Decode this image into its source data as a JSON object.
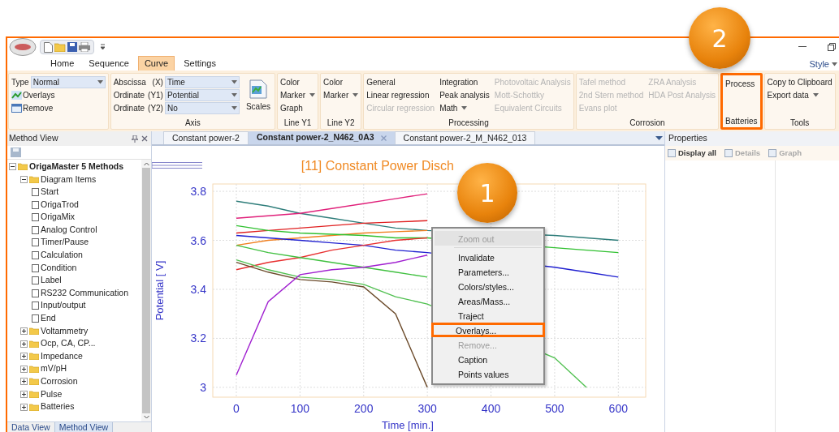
{
  "app": {
    "tabs": [
      {
        "label": "Home",
        "selected": false
      },
      {
        "label": "Sequence",
        "selected": false
      },
      {
        "label": "Curve",
        "selected": true
      },
      {
        "label": "Settings",
        "selected": false
      }
    ],
    "style_menu": "Style"
  },
  "ribbon": [
    {
      "highlighted": false,
      "columns": [
        [
          {
            "kind": "dropdown",
            "label": "Type",
            "value": "Normal"
          },
          {
            "kind": "icon-command",
            "label": "Overlays"
          },
          {
            "kind": "icon-command",
            "label": "Remove"
          }
        ]
      ]
    },
    {
      "label": "Axis",
      "highlighted": false,
      "columns": [
        [
          {
            "kind": "dropdown",
            "label": "Abscissa",
            "tag": "(X)",
            "value": "Time"
          },
          {
            "kind": "dropdown",
            "label": "Ordinate",
            "tag": "(Y1)",
            "value": "Potential"
          },
          {
            "kind": "dropdown",
            "label": "Ordinate",
            "tag": "(Y2)",
            "value": "No"
          }
        ],
        [
          {
            "kind": "large-button",
            "label": "Scales"
          }
        ]
      ]
    },
    {
      "label": "Line Y1",
      "highlighted": false,
      "columns": [
        [
          {
            "kind": "command",
            "label": "Color",
            "disabled": false
          },
          {
            "kind": "menu",
            "label": "Marker",
            "disabled": false
          },
          {
            "kind": "command",
            "label": "Graph",
            "disabled": false
          }
        ]
      ]
    },
    {
      "label": "Line Y2",
      "highlighted": false,
      "columns": [
        [
          {
            "kind": "command",
            "label": "Color",
            "disabled": false
          },
          {
            "kind": "menu",
            "label": "Marker",
            "disabled": false
          }
        ]
      ]
    },
    {
      "label": "Processing",
      "highlighted": false,
      "columns": [
        [
          {
            "kind": "command",
            "label": "General",
            "disabled": false
          },
          {
            "kind": "command",
            "label": "Linear regression",
            "disabled": false
          },
          {
            "kind": "command",
            "label": "Circular regression",
            "disabled": true
          }
        ],
        [
          {
            "kind": "command",
            "label": "Integration",
            "disabled": false
          },
          {
            "kind": "command",
            "label": "Peak analysis",
            "disabled": false
          },
          {
            "kind": "menu",
            "label": "Math",
            "disabled": false
          }
        ],
        [
          {
            "kind": "command",
            "label": "Photovoltaic Analysis",
            "disabled": true
          },
          {
            "kind": "command",
            "label": "Mott-Schottky",
            "disabled": true
          },
          {
            "kind": "command",
            "label": "Equivalent Circuits",
            "disabled": true
          }
        ]
      ]
    },
    {
      "label": "Corrosion",
      "highlighted": false,
      "columns": [
        [
          {
            "kind": "command",
            "label": "Tafel method",
            "disabled": true
          },
          {
            "kind": "command",
            "label": "2nd Stern method",
            "disabled": true
          },
          {
            "kind": "command",
            "label": "Evans plot",
            "disabled": true
          }
        ],
        [
          {
            "kind": "command",
            "label": "ZRA Analysis",
            "disabled": true
          },
          {
            "kind": "command",
            "label": "HDA Post Analysis",
            "disabled": true
          }
        ]
      ]
    },
    {
      "label": "Batteries",
      "highlighted": true,
      "columns": [
        [
          {
            "kind": "command",
            "label": "Process",
            "disabled": false
          }
        ]
      ]
    },
    {
      "label": "Tools",
      "highlighted": false,
      "columns": [
        [
          {
            "kind": "command",
            "label": "Copy to Clipboard",
            "disabled": false
          },
          {
            "kind": "menu",
            "label": "Export data",
            "disabled": false
          }
        ]
      ]
    }
  ],
  "method_view": {
    "title": "Method View",
    "tree": [
      {
        "label": "OrigaMaster 5 Methods",
        "kind": "folder",
        "expanded": true,
        "children": [
          {
            "label": "Diagram Items",
            "kind": "folder",
            "expanded": true,
            "children": [
              {
                "label": "Start",
                "kind": "leaf"
              },
              {
                "label": "OrigaTrod",
                "kind": "leaf"
              },
              {
                "label": "OrigaMix",
                "kind": "leaf"
              },
              {
                "label": "Analog Control",
                "kind": "leaf"
              },
              {
                "label": "Timer/Pause",
                "kind": "leaf"
              },
              {
                "label": "Calculation",
                "kind": "leaf"
              },
              {
                "label": "Condition",
                "kind": "leaf"
              },
              {
                "label": "Label",
                "kind": "leaf"
              },
              {
                "label": "RS232 Communication",
                "kind": "leaf"
              },
              {
                "label": "Input/output",
                "kind": "leaf"
              },
              {
                "label": "End",
                "kind": "leaf"
              }
            ]
          },
          {
            "label": "Voltammetry",
            "kind": "folder",
            "expanded": false
          },
          {
            "label": "Ocp, CA, CP...",
            "kind": "folder",
            "expanded": false
          },
          {
            "label": "Impedance",
            "kind": "folder",
            "expanded": false
          },
          {
            "label": "mV/pH",
            "kind": "folder",
            "expanded": false
          },
          {
            "label": "Corrosion",
            "kind": "folder",
            "expanded": false
          },
          {
            "label": "Pulse",
            "kind": "folder",
            "expanded": false
          },
          {
            "label": "Batteries",
            "kind": "folder",
            "expanded": false
          }
        ]
      }
    ],
    "bottom_tabs": [
      {
        "label": "Data View",
        "selected": false
      },
      {
        "label": "Method View",
        "selected": true
      }
    ]
  },
  "document": {
    "tabs": [
      {
        "label": "Constant power-2",
        "selected": false
      },
      {
        "label": "Constant power-2_N462_0A3",
        "selected": true
      },
      {
        "label": "Constant power-2_M_N462_013",
        "selected": false
      }
    ],
    "chart_data": {
      "type": "line",
      "title": "[11] Constant Power Disch",
      "xlabel": "Time [min.]",
      "ylabel": "Potential [ V]",
      "x": [
        0,
        50,
        100,
        150,
        200,
        250,
        300,
        500,
        550,
        600
      ],
      "xlim": [
        -37,
        643
      ],
      "ylim": [
        2.96,
        3.83
      ],
      "xticks": [
        0,
        100,
        200,
        300,
        400,
        500,
        600
      ],
      "yticks": [
        {
          "value": 3,
          "label": "3"
        },
        3.2,
        3.4,
        3.6,
        3.8
      ],
      "grid": true,
      "series": [
        {
          "color": "#2e7d7a",
          "values": [
            3.76,
            3.74,
            3.71,
            3.69,
            3.67,
            3.65,
            3.64,
            3.62,
            3.61,
            3.6
          ]
        },
        {
          "color": "#e0207a",
          "values": [
            3.69,
            3.7,
            3.71,
            3.73,
            3.75,
            3.77,
            3.79,
            null,
            null,
            null
          ]
        },
        {
          "color": "#e02020",
          "values": [
            3.63,
            3.64,
            3.65,
            3.66,
            3.67,
            3.675,
            3.68,
            null,
            null,
            null
          ]
        },
        {
          "color": "#f08020",
          "values": [
            3.58,
            3.6,
            3.61,
            3.62,
            3.63,
            3.635,
            3.64,
            null,
            null,
            null
          ]
        },
        {
          "color": "#30c030",
          "values": [
            3.66,
            3.64,
            3.63,
            3.625,
            3.62,
            3.61,
            3.61,
            3.57,
            3.56,
            3.55
          ]
        },
        {
          "color": "#2020d0",
          "values": [
            3.62,
            3.61,
            3.6,
            3.59,
            3.58,
            3.56,
            3.55,
            3.49,
            3.47,
            3.45
          ]
        },
        {
          "color": "#e83030",
          "values": [
            3.48,
            3.51,
            3.53,
            3.56,
            3.58,
            3.6,
            3.61,
            null,
            null,
            null
          ]
        },
        {
          "color": "#40c040",
          "values": [
            3.58,
            3.55,
            3.53,
            3.51,
            3.49,
            3.47,
            3.45,
            null,
            null,
            null
          ]
        },
        {
          "color": "#50c050",
          "values": [
            3.52,
            3.48,
            3.45,
            3.44,
            3.42,
            3.37,
            3.34,
            3.12,
            3.0,
            null
          ]
        },
        {
          "color": "#6b4a2a",
          "values": [
            3.51,
            3.47,
            3.44,
            3.43,
            3.41,
            3.3,
            3.0,
            null,
            null,
            null
          ]
        },
        {
          "color": "#a020d0",
          "values": [
            3.05,
            3.35,
            3.46,
            3.48,
            3.49,
            3.51,
            3.54,
            null,
            null,
            null
          ]
        }
      ]
    },
    "context_menu": [
      {
        "label": "Zoom out",
        "disabled": true,
        "hovered": true,
        "highlighted": false
      },
      {
        "kind": "separator"
      },
      {
        "label": "Invalidate",
        "disabled": false,
        "hovered": false,
        "highlighted": false
      },
      {
        "label": "Parameters...",
        "disabled": false,
        "hovered": false,
        "highlighted": false
      },
      {
        "label": "Colors/styles...",
        "disabled": false,
        "hovered": false,
        "highlighted": false
      },
      {
        "label": "Areas/Mass...",
        "disabled": false,
        "hovered": false,
        "highlighted": false
      },
      {
        "label": "Traject",
        "disabled": false,
        "hovered": false,
        "highlighted": false
      },
      {
        "label": "Overlays...",
        "disabled": false,
        "hovered": false,
        "highlighted": true
      },
      {
        "label": "Remove...",
        "disabled": true,
        "hovered": false,
        "highlighted": false
      },
      {
        "label": "Caption",
        "disabled": false,
        "hovered": false,
        "highlighted": false
      },
      {
        "label": "Points values",
        "disabled": false,
        "hovered": false,
        "highlighted": false
      }
    ]
  },
  "properties": {
    "title": "Properties",
    "toolbar": [
      {
        "label": "Display all",
        "disabled": false
      },
      {
        "label": "Details",
        "disabled": true
      },
      {
        "label": "Graph",
        "disabled": true
      }
    ]
  },
  "callouts": [
    {
      "label": "1"
    },
    {
      "label": "2"
    }
  ]
}
